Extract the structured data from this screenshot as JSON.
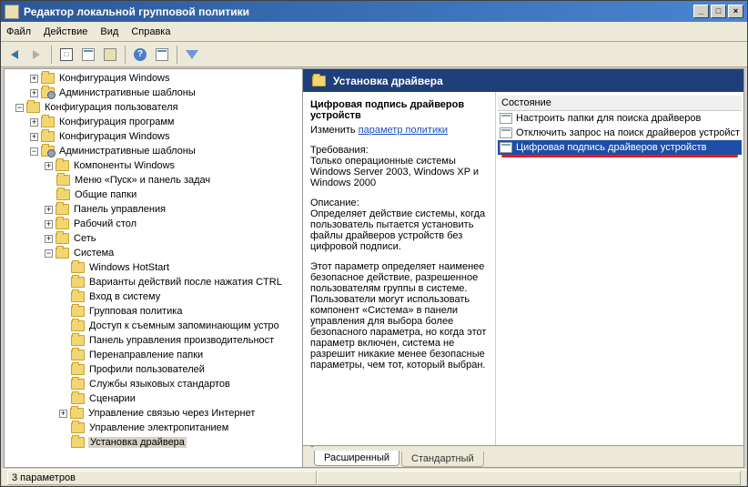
{
  "window": {
    "title": "Редактор локальной групповой политики",
    "min": "_",
    "max": "□",
    "close": "×"
  },
  "menu": {
    "file": "Файл",
    "action": "Действие",
    "view": "Вид",
    "help": "Справка"
  },
  "tree": {
    "root": "",
    "n1": "Конфигурация Windows",
    "n2": "Административные шаблоны",
    "n3": "Конфигурация пользователя",
    "n3a": "Конфигурация программ",
    "n3b": "Конфигурация Windows",
    "n3c": "Административные шаблоны",
    "n3c1": "Компоненты Windows",
    "n3c2": "Меню «Пуск» и панель задач",
    "n3c3": "Общие папки",
    "n3c4": "Панель управления",
    "n3c5": "Рабочий стол",
    "n3c6": "Сеть",
    "n3c7": "Система",
    "n3c7a": "Windows HotStart",
    "n3c7b": "Варианты действий после нажатия CTRL",
    "n3c7c": "Вход в систему",
    "n3c7d": "Групповая политика",
    "n3c7e": "Доступ к съемным запоминающим устро",
    "n3c7f": "Панель управления производительност",
    "n3c7g": "Перенаправление папки",
    "n3c7h": "Профили пользователей",
    "n3c7i": "Службы языковых стандартов",
    "n3c7j": "Сценарии",
    "n3c7k": "Управление связью через Интернет",
    "n3c7l": "Управление электропитанием",
    "n3c7m": "Установка драйвера"
  },
  "right": {
    "header": "Установка драйвера",
    "policy_title": "Цифровая подпись драйверов устройств",
    "edit_label": "Изменить",
    "edit_link": "параметр политики",
    "req_label": "Требования:",
    "req_text": "Только операционные системы Windows Server 2003, Windows XP и Windows 2000",
    "desc_label": "Описание:",
    "desc1": "Определяет действие системы, когда пользователь пытается установить файлы драйверов устройств без цифровой подписи.",
    "desc2": "Этот параметр определяет наименее безопасное действие, разрешенное пользователям группы в системе. Пользователи могут использовать компонент «Система» в панели управления для выбора более безопасного параметра, но когда этот параметр включен, система не разрешит никакие менее безопасные параметры, чем тот, который выбран.",
    "state_col": "Состояние",
    "item1": "Настроить папки для поиска драйверов",
    "item2": "Отключить запрос на поиск драйверов устройст",
    "item3": "Цифровая подпись драйверов устройств"
  },
  "tabs": {
    "extended": "Расширенный",
    "standard": "Стандартный"
  },
  "status": {
    "count": "3 параметров"
  }
}
